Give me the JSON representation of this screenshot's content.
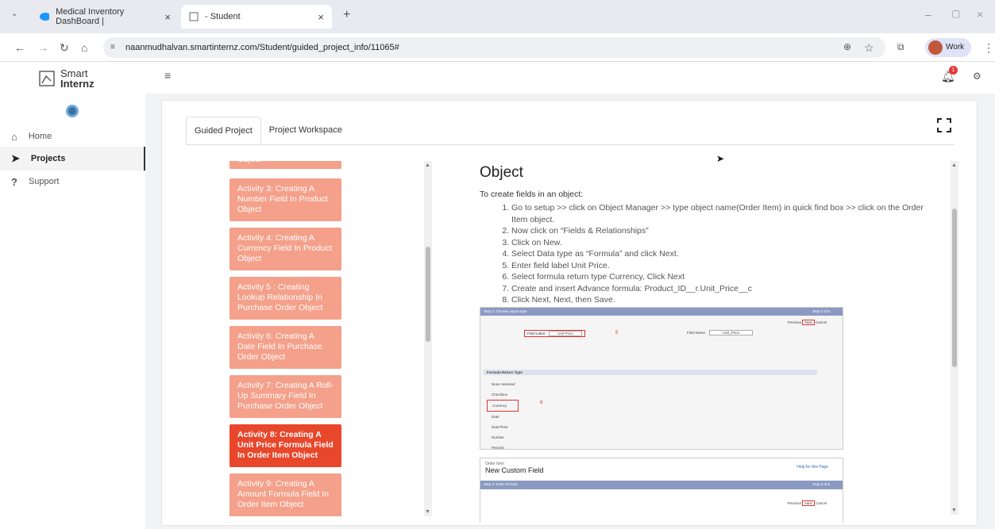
{
  "browser": {
    "tabs": [
      {
        "title": "Medical Inventory DashBoard |"
      },
      {
        "title": "- Student"
      }
    ],
    "url": "naanmudhalvan.smartinternz.com/Student/guided_project_info/11065#",
    "profile": "Work",
    "colors": {
      "frame": "#e8eaf0",
      "url_bg": "#eef0f4"
    }
  },
  "app": {
    "logo_line1": "Smart",
    "logo_line2": "Internz",
    "nav": [
      {
        "label": "Home"
      },
      {
        "label": "Projects"
      },
      {
        "label": "Support"
      }
    ],
    "notification_count": "1"
  },
  "project": {
    "tabs": [
      {
        "label": "Guided Project"
      },
      {
        "label": "Project Workspace"
      }
    ],
    "activities": [
      {
        "label": "Object"
      },
      {
        "label": "Activity 3: Creating A Number Field In Product Object"
      },
      {
        "label": "Activity 4: Creating A Currency Field In Product Object"
      },
      {
        "label": "Activity 5 : Creating Lookup Relationship In Purchase Order Object"
      },
      {
        "label": "Activity 6: Creating A Date Field In Purchase Order Object"
      },
      {
        "label": "Activity 7: Creating A Roll-Up Summary Field In Purchase Order Object"
      },
      {
        "label": "Activity 8: Creating A Unit Price Formula Field In Order Item Object"
      },
      {
        "label": "Activity 9: Creating A Amount Formula Field In Order Item Object"
      }
    ],
    "colors": {
      "activity": "#f4a08a",
      "activity_selected": "#e8472b"
    }
  },
  "content": {
    "heading": "Object",
    "intro": "To create fields in an object:",
    "steps": [
      "Go to setup >> click on Object Manager >> type object name(Order Item) in quick find box >> click on the Order Item object.",
      "Now click on “Fields & Relationships”",
      "Click on New.",
      "Select Data type as “Formula” and click Next.",
      "Enter field label Unit Price.",
      "Select formula return type Currency, Click Next",
      "Create and insert Advance formula: Product_ID__r.Unit_Price__c",
      "Click Next, Next, then Save."
    ],
    "screenshot1": {
      "step_title": "Step 2. Choose output type",
      "step_count": "Step 2 of 5",
      "field_label_label": "Field Label",
      "field_label_value": "Unit Price",
      "field_name_label": "Field Name",
      "field_name_value": "Unit_Price",
      "marker5": "5",
      "return_type_header": "Formula Return Type",
      "options": [
        "None Selected",
        "Checkbox",
        "Currency",
        "Date",
        "Date/Time",
        "Number",
        "Percent"
      ],
      "marker6": "6",
      "previous": "Previous",
      "next": "Next",
      "cancel": "Cancel"
    },
    "screenshot2": {
      "subtitle": "Order Item",
      "title": "New Custom Field",
      "help": "Help for this Page",
      "step_title": "Step 3. Enter formula",
      "step_count": "Step 3 of 5",
      "previous": "Previous",
      "next": "Next",
      "cancel": "Cancel"
    }
  }
}
